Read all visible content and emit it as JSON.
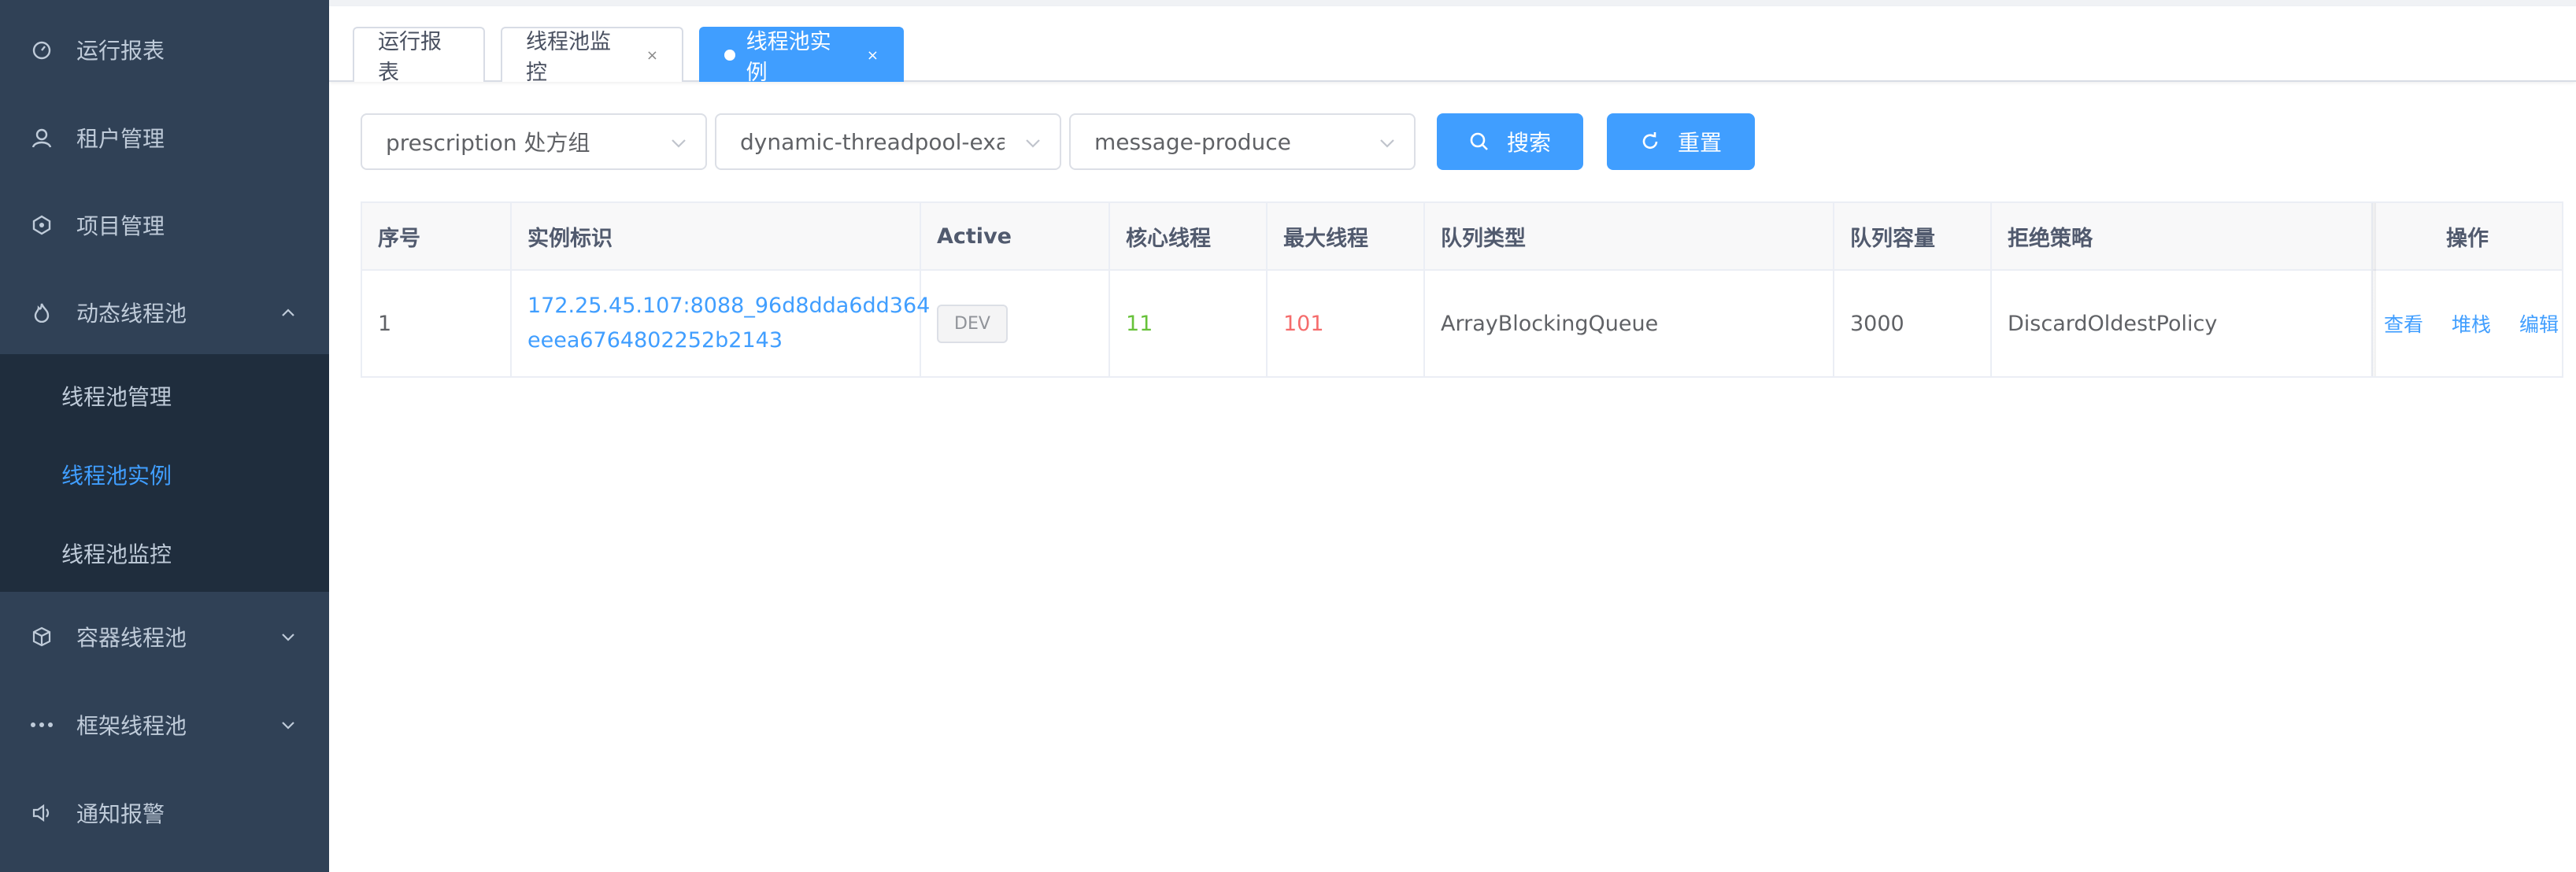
{
  "sidebar": {
    "items": [
      {
        "label": "运行报表",
        "icon": "dashboard-icon"
      },
      {
        "label": "租户管理",
        "icon": "user-icon"
      },
      {
        "label": "项目管理",
        "icon": "project-icon"
      },
      {
        "label": "动态线程池",
        "icon": "flame-icon",
        "expanded": true
      },
      {
        "label": "容器线程池",
        "icon": "cube-icon"
      },
      {
        "label": "框架线程池",
        "icon": "more-icon"
      },
      {
        "label": "通知报警",
        "icon": "speaker-icon"
      }
    ],
    "submenu": [
      {
        "label": "线程池管理"
      },
      {
        "label": "线程池实例",
        "active": true
      },
      {
        "label": "线程池监控"
      }
    ]
  },
  "tags": [
    {
      "label": "运行报表"
    },
    {
      "label": "线程池监控",
      "close": "×"
    },
    {
      "label": "线程池实例",
      "close": "×",
      "active": true
    }
  ],
  "filters": {
    "tenant": "prescription 处方组",
    "item": "dynamic-threadpool-example",
    "thread_pool": "message-produce",
    "search_label": "搜索",
    "reset_label": "重置"
  },
  "table": {
    "headers": [
      "序号",
      "实例标识",
      "Active",
      "核心线程",
      "最大线程",
      "队列类型",
      "队列容量",
      "拒绝策略",
      "操作"
    ],
    "rows": [
      {
        "index": "1",
        "instance_line1": "172.25.45.107:8088_96d8dda6dd364",
        "instance_line2": "eeea6764802252b2143",
        "active": "DEV",
        "core": "11",
        "max": "101",
        "queue_type": "ArrayBlockingQueue",
        "queue_capacity": "3000",
        "reject_policy": "DiscardOldestPolicy",
        "actions": [
          "查看",
          "堆栈",
          "编辑"
        ]
      }
    ]
  },
  "colors": {
    "sidebar_bg": "#304156",
    "submenu_bg": "#1f2d3d",
    "accent": "#409eff",
    "core_green": "#67c23a",
    "max_red": "#f56c6c"
  }
}
